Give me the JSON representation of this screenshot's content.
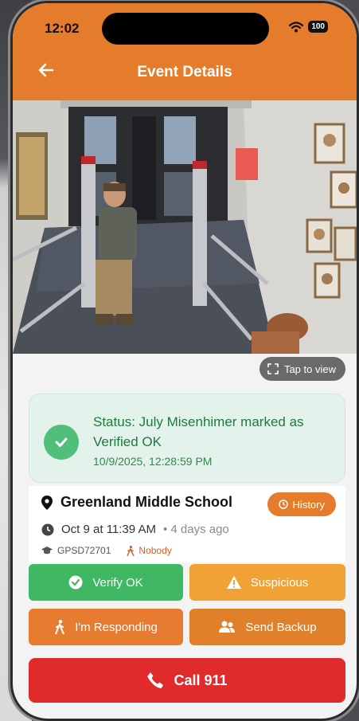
{
  "status_bar": {
    "time": "12:02",
    "battery": "100"
  },
  "header": {
    "title": "Event Details"
  },
  "camera": {
    "tap_label": "Tap to view"
  },
  "status": {
    "text": "Status: July Misenhimer marked as Verified OK",
    "timestamp": "10/9/2025, 12:28:59 PM"
  },
  "event": {
    "location": "Greenland Middle School",
    "history_label": "History",
    "date": "Oct 9 at 11:39 AM",
    "ago": "• 4 days ago",
    "device_id": "GPSD72701",
    "responder": "Nobody"
  },
  "actions": {
    "verify": "Verify OK",
    "suspicious": "Suspicious",
    "responding": "I'm Responding",
    "backup": "Send Backup",
    "call": "Call 911"
  },
  "colors": {
    "header": "#e57c2c",
    "verify": "#3fb763",
    "suspicious": "#f1a234",
    "call": "#e12a2c",
    "status_text": "#1f7a3e"
  }
}
